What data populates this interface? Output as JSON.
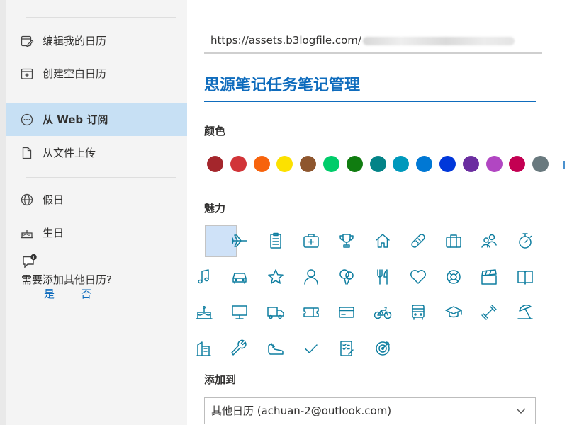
{
  "sidebar": {
    "items": [
      {
        "label": "编辑我的日历",
        "icon": "edit-calendar-icon"
      },
      {
        "label": "创建空白日历",
        "icon": "blank-calendar-icon"
      },
      {
        "label": "从 Web 订阅",
        "icon": "web-subscribe-icon",
        "active": true
      },
      {
        "label": "从文件上传",
        "icon": "file-upload-icon"
      },
      {
        "label": "假日",
        "icon": "globe-icon"
      },
      {
        "label": "生日",
        "icon": "birthday-cake-icon"
      }
    ],
    "prompt": {
      "text": "需要添加其他日历?",
      "yes": "是",
      "no": "否",
      "icon": "chat-bubble-icon"
    }
  },
  "main": {
    "url_value": "https://assets.b3logfile.com/",
    "calendar_name": "思源笔记任务笔记管理",
    "color_label": "颜色",
    "colors": [
      "#a4262c",
      "#d13438",
      "#f7630c",
      "#fce100",
      "#8e562e",
      "#00cc6a",
      "#107c10",
      "#038387",
      "#0099bc",
      "#0078d4",
      "#0037da",
      "#6b2ea0",
      "#b146c2",
      "#c30052",
      "#69797e"
    ],
    "charm_label": "魅力",
    "charms": [
      "none-charm",
      "airplane-icon",
      "clipboard-icon",
      "first-aid-kit-icon",
      "trophy-icon",
      "home-icon",
      "bandage-icon",
      "briefcase-icon",
      "people-icon",
      "stopwatch-icon",
      "music-note-icon",
      "car-icon",
      "star-icon",
      "person-icon",
      "balloon-icon",
      "fork-knife-icon",
      "heart-icon",
      "lifebuoy-icon",
      "clapperboard-icon",
      "book-icon",
      "birthday-cake-icon",
      "monitor-icon",
      "truck-icon",
      "ticket-icon",
      "credit-card-icon",
      "bicycle-icon",
      "bus-icon",
      "graduation-cap-icon",
      "dumbbell-icon",
      "beach-umbrella-icon",
      "building-icon",
      "wrench-icon",
      "sneaker-icon",
      "checkmark-icon",
      "checklist-icon",
      "target-icon"
    ],
    "add_to_label": "添加到",
    "add_to_value": "其他日历 (achuan-2@outlook.com)"
  }
}
